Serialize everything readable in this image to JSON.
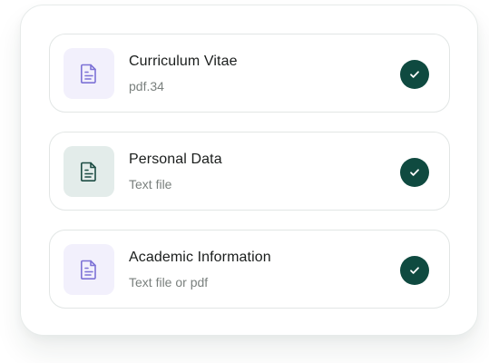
{
  "colors": {
    "accent_dark_green": "#0f4a40",
    "lavender_icon": "#7d72d6",
    "green_icon": "#1d4d44"
  },
  "files": [
    {
      "title": "Curriculum Vitae",
      "subtitle": "pdf.34",
      "icon": "document-icon",
      "status_icon": "check-icon"
    },
    {
      "title": "Personal Data",
      "subtitle": "Text file",
      "icon": "document-icon",
      "status_icon": "check-icon"
    },
    {
      "title": "Academic Information",
      "subtitle": "Text file or pdf",
      "icon": "document-icon",
      "status_icon": "check-icon"
    }
  ]
}
